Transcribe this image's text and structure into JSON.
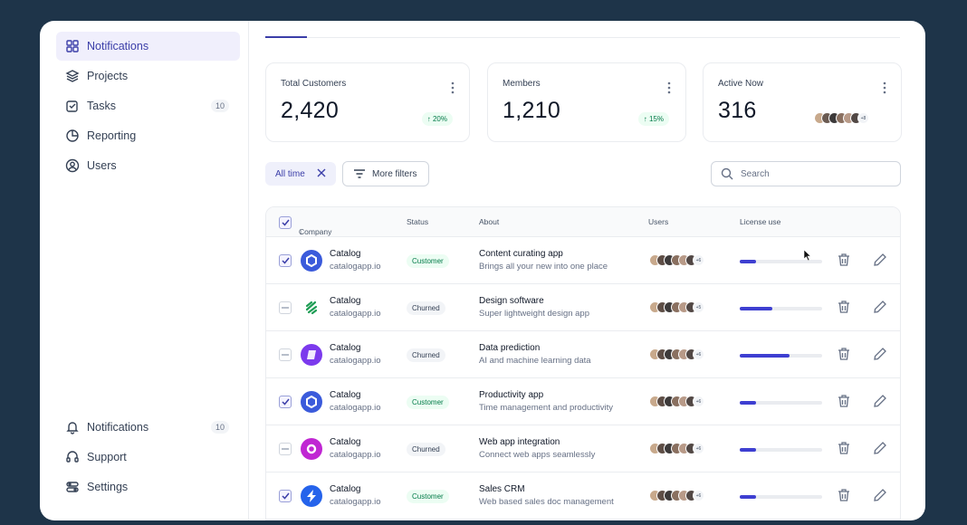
{
  "sidebar": {
    "top_items": [
      {
        "label": "Notifications",
        "icon": "grid-icon",
        "active": true
      },
      {
        "label": "Projects",
        "icon": "layers-icon"
      },
      {
        "label": "Tasks",
        "icon": "check-square-icon",
        "count": "10"
      },
      {
        "label": "Reporting",
        "icon": "pie-chart-icon"
      },
      {
        "label": "Users",
        "icon": "user-circle-icon"
      }
    ],
    "bottom_items": [
      {
        "label": "Notifications",
        "icon": "bell-icon",
        "count": "10"
      },
      {
        "label": "Support",
        "icon": "support-icon"
      },
      {
        "label": "Settings",
        "icon": "settings-icon"
      }
    ]
  },
  "stats": [
    {
      "title": "Total Customers",
      "value": "2,420",
      "trend": "20%"
    },
    {
      "title": "Members",
      "value": "1,210",
      "trend": "15%"
    },
    {
      "title": "Active Now",
      "value": "316",
      "avatars_more": "+8"
    }
  ],
  "filters": {
    "chip_label": "All time",
    "more_filters_label": "More filters",
    "search_placeholder": "Search"
  },
  "table": {
    "columns": {
      "company": "Company",
      "status": "Status",
      "about": "About",
      "users": "Users",
      "license": "License use"
    },
    "rows": [
      {
        "name": "Catalog",
        "domain": "catalogapp.io",
        "status": "Customer",
        "about_title": "Content curating app",
        "about_sub": "Brings all your new into one place",
        "users_more": "+6",
        "license_fraction": 0.2,
        "checked": true,
        "logo_color": "#3b5bdb"
      },
      {
        "name": "Catalog",
        "domain": "catalogapp.io",
        "status": "Churned",
        "about_title": "Design software",
        "about_sub": "Super lightweight design app",
        "users_more": "+5",
        "license_fraction": 0.4,
        "checked": false,
        "logo_color": "#1f9d55"
      },
      {
        "name": "Catalog",
        "domain": "catalogapp.io",
        "status": "Churned",
        "about_title": "Data prediction",
        "about_sub": "AI and machine learning data",
        "users_more": "+6",
        "license_fraction": 0.6,
        "checked": false,
        "logo_color": "#7c3aed"
      },
      {
        "name": "Catalog",
        "domain": "catalogapp.io",
        "status": "Customer",
        "about_title": "Productivity app",
        "about_sub": "Time management and productivity",
        "users_more": "+6",
        "license_fraction": 0.2,
        "checked": true,
        "logo_color": "#3b5bdb"
      },
      {
        "name": "Catalog",
        "domain": "catalogapp.io",
        "status": "Churned",
        "about_title": "Web app integration",
        "about_sub": "Connect web apps seamlessly",
        "users_more": "+6",
        "license_fraction": 0.2,
        "checked": false,
        "logo_color": "#c026d3"
      },
      {
        "name": "Catalog",
        "domain": "catalogapp.io",
        "status": "Customer",
        "about_title": "Sales CRM",
        "about_sub": "Web based sales doc management",
        "users_more": "+6",
        "license_fraction": 0.2,
        "checked": true,
        "logo_color": "#2563eb"
      }
    ]
  },
  "colors": {
    "accent": "#3e3fd1",
    "background": "#1e3449"
  }
}
